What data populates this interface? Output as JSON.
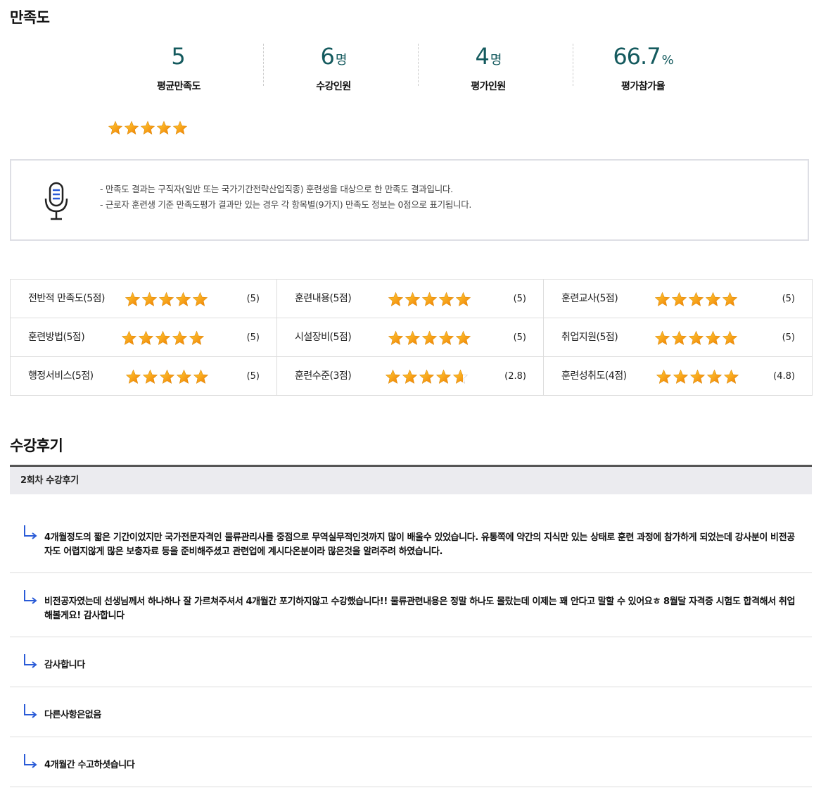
{
  "satisfaction": {
    "title": "만족도",
    "stats": [
      {
        "value": "5",
        "unit": "",
        "label": "평균만족도"
      },
      {
        "value": "6",
        "unit": "명",
        "label": "수강인원"
      },
      {
        "value": "4",
        "unit": "명",
        "label": "평가인원"
      },
      {
        "value": "66.7",
        "unit": "%",
        "label": "평가참가율"
      }
    ],
    "overall_rating": 5,
    "notice": [
      "- 만족도 결과는 구직자(일반 또는 국가기간전략산업직종) 훈련생을 대상으로 한 만족도 결과입니다.",
      "- 근로자 훈련생 기준 만족도평가 결과만 있는 경우 각 항목별(9가지) 만족도 정보는 0점으로 표기됩니다."
    ],
    "items": [
      {
        "label": "전반적 만족도(5점)",
        "score": "(5)",
        "rating": 5
      },
      {
        "label": "훈련내용(5점)",
        "score": "(5)",
        "rating": 5
      },
      {
        "label": "훈련교사(5점)",
        "score": "(5)",
        "rating": 5
      },
      {
        "label": "훈련방법(5점)",
        "score": "(5)",
        "rating": 5
      },
      {
        "label": "시설장비(5점)",
        "score": "(5)",
        "rating": 5
      },
      {
        "label": "취업지원(5점)",
        "score": "(5)",
        "rating": 5
      },
      {
        "label": "행정서비스(5점)",
        "score": "(5)",
        "rating": 5
      },
      {
        "label": "훈련수준(3점)",
        "score": "(2.8)",
        "rating": 4.67
      },
      {
        "label": "훈련성취도(4점)",
        "score": "(4.8)",
        "rating": 5
      }
    ]
  },
  "reviews": {
    "title": "수강후기",
    "round_label": "2회차 수강후기",
    "items": [
      "4개월정도의 짧은 기간이었지만 국가전문자격인 물류관리사를 중점으로 무역실무적인것까지 많이 배울수 있었습니다. 유통쪽에 약간의 지식만 있는 상태로 훈련 과정에 참가하게 되었는데 강사분이 비전공자도 어렵지않게 많은 보충자료 등을 준비해주셨고 관련업에 계시다온분이라 많은것을 알려주려 하였습니다.",
      "비전공자였는데 선생님께서 하나하나 잘 가르쳐주셔서 4개월간 포기하지않고 수강했습니다!! 물류관련내용은 정말 하나도 몰랐는데 이제는 꽤 안다고 말할 수 있어요ㅎ 8월달 자격증 시험도 합격해서 취업해볼게요! 감사합니다",
      "감사합니다",
      "다른사항은없음",
      "4개월간 수고하셧습니다"
    ]
  },
  "colors": {
    "accent": "#145a5e",
    "star_fill": "#f5a10f",
    "star_empty": "#cccccc",
    "arrow": "#2a5bd7"
  }
}
